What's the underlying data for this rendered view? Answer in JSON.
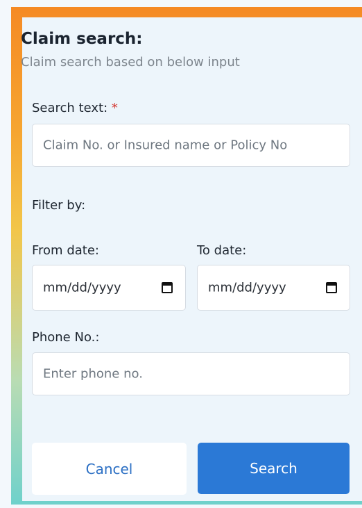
{
  "form": {
    "title": "Claim search:",
    "subtitle": "Claim search based on below input",
    "search_text": {
      "label": "Search text:",
      "required_marker": "*",
      "placeholder": "Claim No. or Insured name or Policy No"
    },
    "filter_by_label": "Filter by:",
    "from_date": {
      "label": "From date:",
      "value": "mm/dd/yyyy"
    },
    "to_date": {
      "label": "To date:",
      "value": "mm/dd/yyyy"
    },
    "phone": {
      "label": "Phone No.:",
      "placeholder": "Enter phone no."
    }
  },
  "buttons": {
    "cancel_label": "Cancel",
    "search_label": "Search"
  },
  "colors": {
    "accent": "#2b79d6",
    "required": "#d43b35",
    "frame_gradient_top": "#f58a24",
    "frame_gradient_bottom": "#6fd1cb"
  },
  "icons": {
    "date_picker": "calendar-icon"
  }
}
